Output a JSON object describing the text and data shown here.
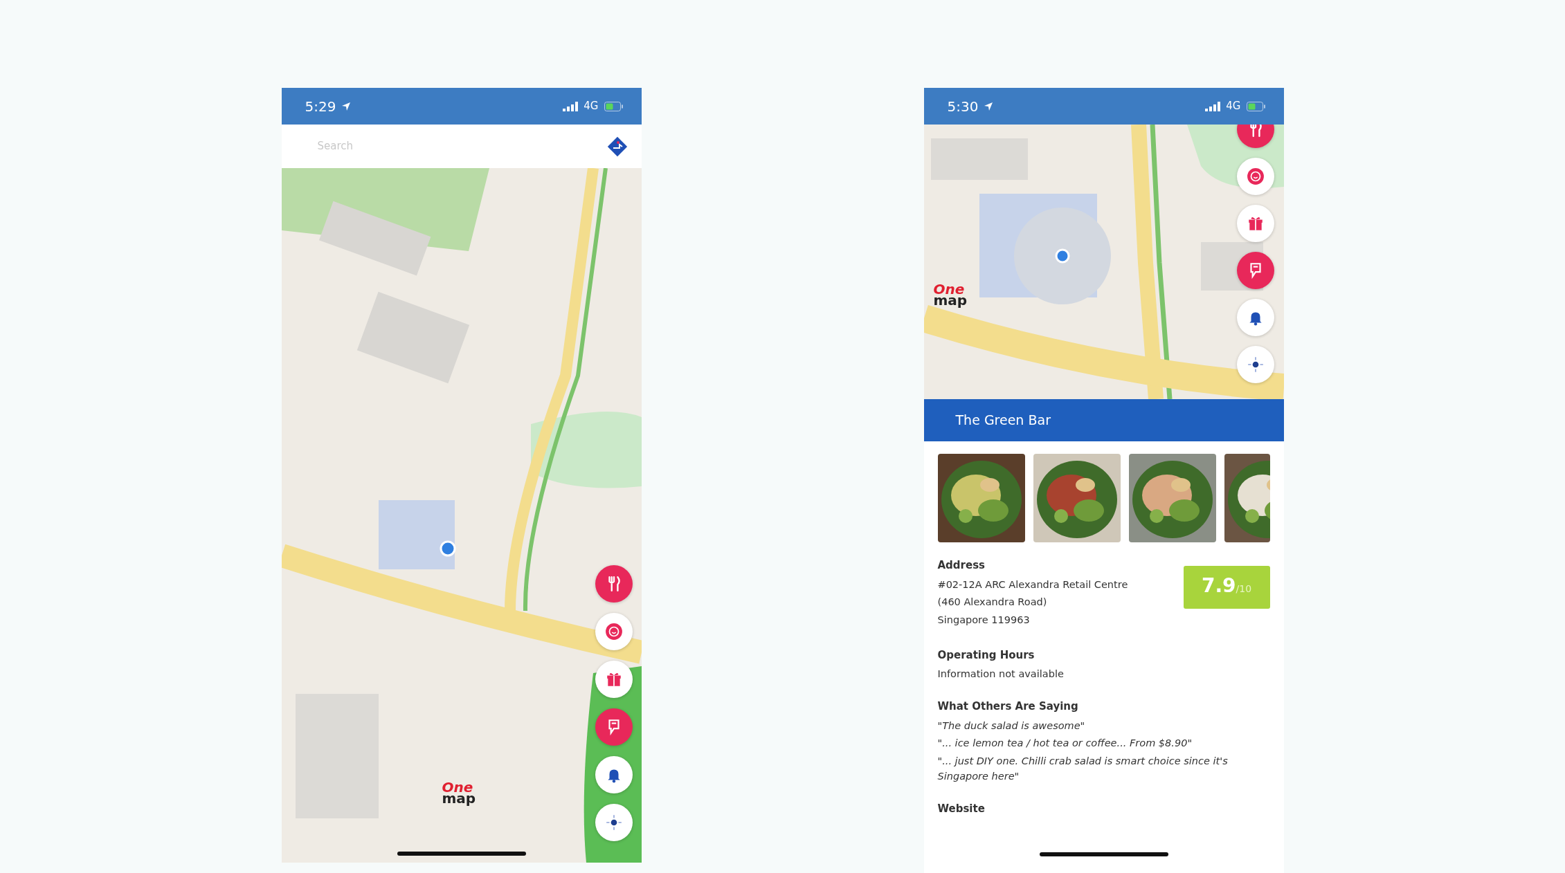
{
  "screens": [
    {
      "status_bar": {
        "time": "5:29",
        "network": "4G"
      },
      "search": {
        "placeholder": "Search"
      },
      "logo": {
        "top": "One",
        "bottom": "map"
      },
      "map_buttons": [
        {
          "kind": "food"
        },
        {
          "kind": "smiley"
        },
        {
          "kind": "gift"
        },
        {
          "kind": "foursquare"
        },
        {
          "kind": "bell"
        },
        {
          "kind": "locate"
        }
      ]
    },
    {
      "status_bar": {
        "time": "5:30",
        "network": "4G"
      },
      "logo": {
        "top": "One",
        "bottom": "map"
      },
      "map_buttons": [
        {
          "kind": "food"
        },
        {
          "kind": "smiley"
        },
        {
          "kind": "gift"
        },
        {
          "kind": "foursquare"
        },
        {
          "kind": "bell"
        },
        {
          "kind": "locate"
        }
      ],
      "place": {
        "title": "The Green Bar",
        "rating": {
          "score": "7.9",
          "scale": "/10"
        },
        "sections": [
          {
            "heading": "Address",
            "lines": [
              "#02-12A ARC Alexandra Retail Centre",
              "(460 Alexandra Road)",
              "Singapore 119963"
            ],
            "italic": false
          },
          {
            "heading": "Operating Hours",
            "lines": [
              "Information not available"
            ],
            "italic": false
          },
          {
            "heading": "What Others Are Saying",
            "lines": [
              "\"The duck salad is awesome\"",
              "\"... ice lemon tea / hot tea or coffee... From $8.90\"",
              "\"... just DIY one. Chilli crab salad is smart choice since it's Singapore here\""
            ],
            "italic": true
          },
          {
            "heading": "Website"
          }
        ]
      }
    }
  ]
}
